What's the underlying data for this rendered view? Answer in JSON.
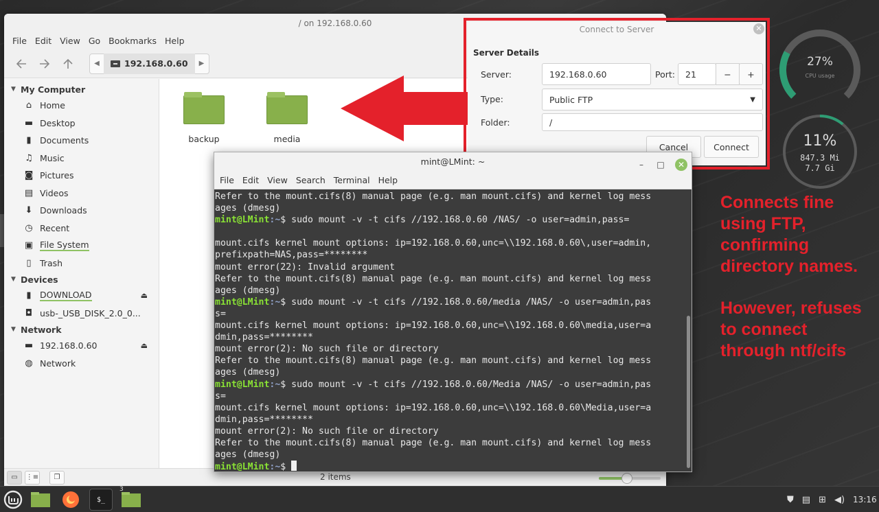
{
  "file_manager": {
    "title": "/ on 192.168.0.60",
    "menu": [
      "File",
      "Edit",
      "View",
      "Go",
      "Bookmarks",
      "Help"
    ],
    "path_crumb": "192.168.0.60",
    "sidebar": {
      "my_computer": {
        "header": "My Computer",
        "items": [
          {
            "label": "Home",
            "icon": "home-icon"
          },
          {
            "label": "Desktop",
            "icon": "desktop-icon"
          },
          {
            "label": "Documents",
            "icon": "documents-icon"
          },
          {
            "label": "Music",
            "icon": "music-icon"
          },
          {
            "label": "Pictures",
            "icon": "pictures-icon"
          },
          {
            "label": "Videos",
            "icon": "videos-icon"
          },
          {
            "label": "Downloads",
            "icon": "downloads-icon"
          },
          {
            "label": "Recent",
            "icon": "recent-icon"
          },
          {
            "label": "File System",
            "icon": "filesystem-icon"
          },
          {
            "label": "Trash",
            "icon": "trash-icon"
          }
        ]
      },
      "devices": {
        "header": "Devices",
        "items": [
          {
            "label": "DOWNLOAD",
            "icon": "usb-drive-icon"
          },
          {
            "label": "usb-_USB_DISK_2.0_0...",
            "icon": "disk-icon"
          }
        ]
      },
      "network": {
        "header": "Network",
        "items": [
          {
            "label": "192.168.0.60",
            "icon": "network-share-icon"
          },
          {
            "label": "Network",
            "icon": "globe-icon"
          }
        ]
      }
    },
    "folders": [
      "backup",
      "media"
    ],
    "status": "2 items",
    "zoom_level": 0.45
  },
  "dialog": {
    "title": "Connect to Server",
    "section": "Server Details",
    "server_label": "Server:",
    "server_value": "192.168.0.60",
    "port_label": "Port:",
    "port_value": "21",
    "minus": "−",
    "plus": "+",
    "type_label": "Type:",
    "type_value": "Public FTP",
    "folder_label": "Folder:",
    "folder_value": "/",
    "cancel": "Cancel",
    "connect": "Connect"
  },
  "terminal": {
    "title": "mint@LMint: ~",
    "menu": [
      "File",
      "Edit",
      "View",
      "Search",
      "Terminal",
      "Help"
    ],
    "prompt_user": "mint@LMint",
    "prompt_dir": ":~",
    "lines": [
      {
        "t": "out",
        "text": "Refer to the mount.cifs(8) manual page (e.g. man mount.cifs) and kernel log mess"
      },
      {
        "t": "out",
        "text": "ages (dmesg)"
      },
      {
        "t": "cmd",
        "text": "$ sudo mount -v -t cifs //192.168.0.60 /NAS/ -o user=admin,pass="
      },
      {
        "t": "out",
        "text": ""
      },
      {
        "t": "out",
        "text": "mount.cifs kernel mount options: ip=192.168.0.60,unc=\\\\192.168.0.60\\,user=admin,"
      },
      {
        "t": "out",
        "text": "prefixpath=NAS,pass=********"
      },
      {
        "t": "out",
        "text": "mount error(22): Invalid argument"
      },
      {
        "t": "out",
        "text": "Refer to the mount.cifs(8) manual page (e.g. man mount.cifs) and kernel log mess"
      },
      {
        "t": "out",
        "text": "ages (dmesg)"
      },
      {
        "t": "cmd",
        "text": "$ sudo mount -v -t cifs //192.168.0.60/media /NAS/ -o user=admin,pas"
      },
      {
        "t": "out",
        "text": "s="
      },
      {
        "t": "out",
        "text": "mount.cifs kernel mount options: ip=192.168.0.60,unc=\\\\192.168.0.60\\media,user=a"
      },
      {
        "t": "out",
        "text": "dmin,pass=********"
      },
      {
        "t": "out",
        "text": "mount error(2): No such file or directory"
      },
      {
        "t": "out",
        "text": "Refer to the mount.cifs(8) manual page (e.g. man mount.cifs) and kernel log mess"
      },
      {
        "t": "out",
        "text": "ages (dmesg)"
      },
      {
        "t": "cmd",
        "text": "$ sudo mount -v -t cifs //192.168.0.60/Media /NAS/ -o user=admin,pas"
      },
      {
        "t": "out",
        "text": "s="
      },
      {
        "t": "out",
        "text": "mount.cifs kernel mount options: ip=192.168.0.60,unc=\\\\192.168.0.60\\Media,user=a"
      },
      {
        "t": "out",
        "text": "dmin,pass=********"
      },
      {
        "t": "out",
        "text": "mount error(2): No such file or directory"
      },
      {
        "t": "out",
        "text": "Refer to the mount.cifs(8) manual page (e.g. man mount.cifs) and kernel log mess"
      },
      {
        "t": "out",
        "text": "ages (dmesg)"
      },
      {
        "t": "cursor",
        "text": "$ "
      }
    ]
  },
  "annotation": {
    "line1": "Connects fine",
    "line2": "using FTP,",
    "line3": "confirming",
    "line4": "directory names.",
    "line5": "However, refuses",
    "line6": "to connect",
    "line7": "through ntf/cifs"
  },
  "desklets": {
    "cpu_percent": "27%",
    "cpu_label": "CPU usage",
    "cpu_fraction": 0.27,
    "mem_percent": "11%",
    "mem_used": "847.3 Mi",
    "mem_total": "7.7 Gi",
    "mem_fraction": 0.11
  },
  "taskbar": {
    "clock": "13:16",
    "badge": "3"
  },
  "colors": {
    "mint_green": "#8fc264",
    "annotation_red": "#e4212b",
    "prompt_green": "#8ae234"
  }
}
